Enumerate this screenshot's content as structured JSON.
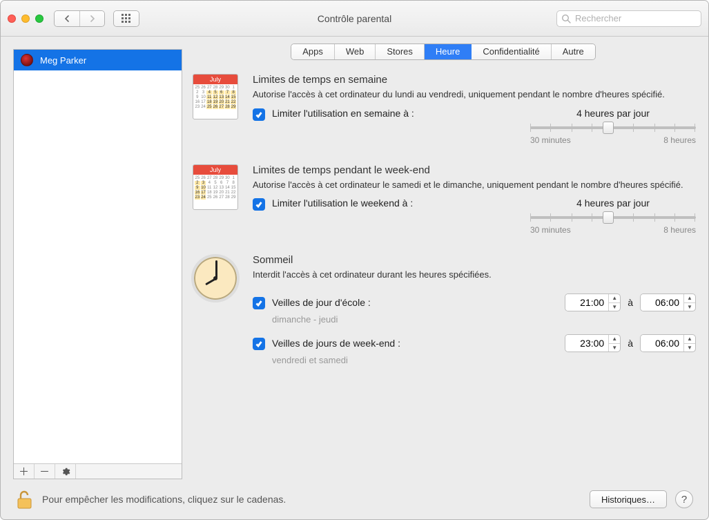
{
  "window": {
    "title": "Contrôle parental"
  },
  "search": {
    "placeholder": "Rechercher"
  },
  "sidebar": {
    "users": [
      {
        "name": "Meg Parker"
      }
    ]
  },
  "tabs": [
    {
      "label": "Apps",
      "active": false
    },
    {
      "label": "Web",
      "active": false
    },
    {
      "label": "Stores",
      "active": false
    },
    {
      "label": "Heure",
      "active": true
    },
    {
      "label": "Confidentialité",
      "active": false
    },
    {
      "label": "Autre",
      "active": false
    }
  ],
  "weekday": {
    "iconMonth": "July",
    "title": "Limites de temps en semaine",
    "desc": "Autorise l'accès à cet ordinateur du lundi au vendredi, uniquement pendant le nombre d'heures spécifié.",
    "checkboxLabel": "Limiter l'utilisation en semaine à :",
    "sliderValue": "4 heures par jour",
    "sliderPositionPct": 47,
    "sliderMinLabel": "30 minutes",
    "sliderMaxLabel": "8 heures"
  },
  "weekend": {
    "iconMonth": "July",
    "title": "Limites de temps pendant le week-end",
    "desc": "Autorise l'accès à cet ordinateur le samedi et le dimanche, uniquement pendant le nombre d'heures spécifié.",
    "checkboxLabel": "Limiter l'utilisation le weekend à :",
    "sliderValue": "4 heures par jour",
    "sliderPositionPct": 47,
    "sliderMinLabel": "30 minutes",
    "sliderMaxLabel": "8 heures"
  },
  "bedtime": {
    "title": "Sommeil",
    "desc": "Interdit l'accès à cet ordinateur durant les heures spécifiées.",
    "schoolLabel": "Veilles de jour d'école :",
    "schoolNote": "dimanche - jeudi",
    "schoolStart": "21:00",
    "schoolEnd": "06:00",
    "weekendLabel": "Veilles de jours de week-end :",
    "weekendNote": "vendredi et samedi",
    "weekendStart": "23:00",
    "weekendEnd": "06:00",
    "toLabel": "à"
  },
  "footer": {
    "lockText": "Pour empêcher les modifications, cliquez sur le cadenas.",
    "logsButton": "Historiques…"
  }
}
